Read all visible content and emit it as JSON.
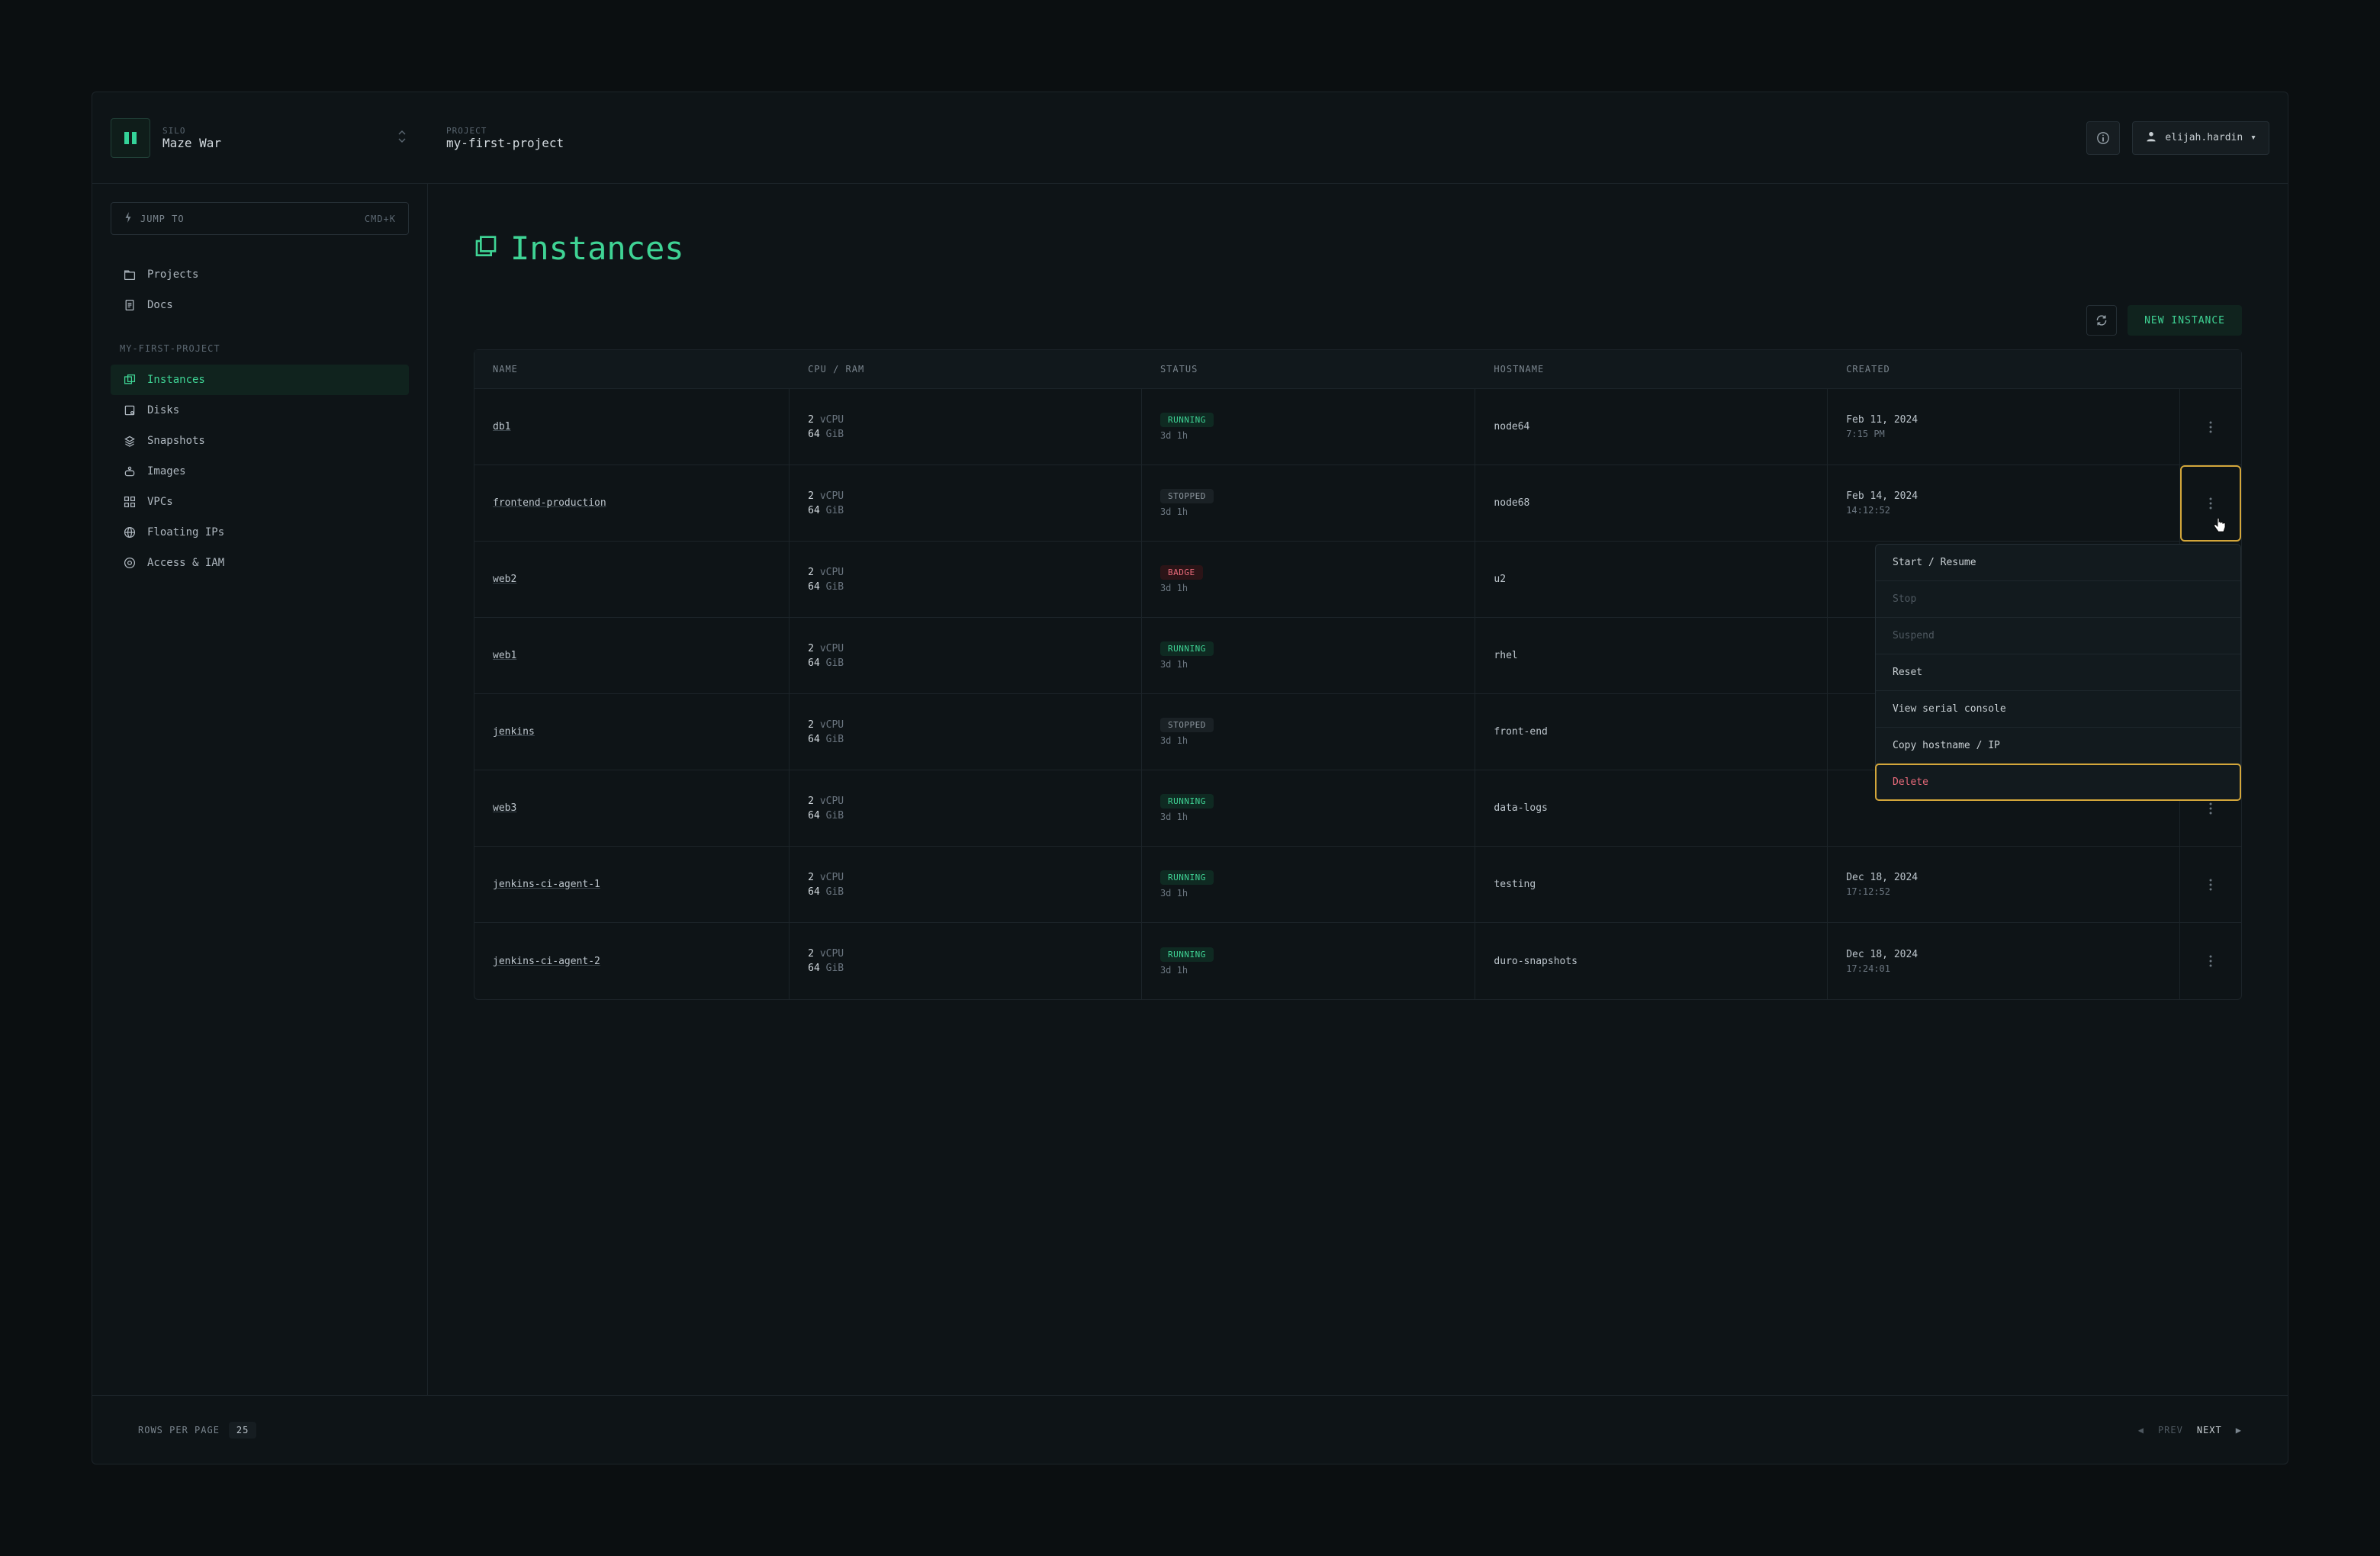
{
  "header": {
    "silo_label": "SILO",
    "silo_name": "Maze War",
    "project_label": "PROJECT",
    "project_name": "my-first-project",
    "username": "elijah.hardin"
  },
  "jump_to": {
    "label": "JUMP TO",
    "kbd": "CMD+K"
  },
  "nav_top": [
    {
      "label": "Projects",
      "icon": "folder"
    },
    {
      "label": "Docs",
      "icon": "doc"
    }
  ],
  "nav_section_label": "MY-FIRST-PROJECT",
  "nav_items": [
    {
      "label": "Instances",
      "icon": "instances",
      "active": true
    },
    {
      "label": "Disks",
      "icon": "disk"
    },
    {
      "label": "Snapshots",
      "icon": "snapshots"
    },
    {
      "label": "Images",
      "icon": "image"
    },
    {
      "label": "VPCs",
      "icon": "vpc"
    },
    {
      "label": "Floating IPs",
      "icon": "globe"
    },
    {
      "label": "Access & IAM",
      "icon": "access"
    }
  ],
  "page_title": "Instances",
  "toolbar": {
    "new_label": "NEW INSTANCE"
  },
  "columns": [
    "NAME",
    "CPU / RAM",
    "STATUS",
    "HOSTNAME",
    "CREATED"
  ],
  "rows": [
    {
      "name": "db1",
      "cpu": "2",
      "cpu_unit": "vCPU",
      "ram": "64",
      "ram_unit": "GiB",
      "status": "RUNNING",
      "status_kind": "running",
      "uptime": "3d 1h",
      "hostname": "node64",
      "created1": "Feb 11, 2024",
      "created2": "7:15 PM"
    },
    {
      "name": "frontend-production",
      "cpu": "2",
      "cpu_unit": "vCPU",
      "ram": "64",
      "ram_unit": "GiB",
      "status": "STOPPED",
      "status_kind": "stopped",
      "uptime": "3d 1h",
      "hostname": "node68",
      "created1": "Feb 14, 2024",
      "created2": "14:12:52",
      "menu_open": true,
      "more_focused": true
    },
    {
      "name": "web2",
      "cpu": "2",
      "cpu_unit": "vCPU",
      "ram": "64",
      "ram_unit": "GiB",
      "status": "BADGE",
      "status_kind": "badge-red",
      "uptime": "3d 1h",
      "hostname": "u2",
      "created1": "",
      "created2": ""
    },
    {
      "name": "web1",
      "cpu": "2",
      "cpu_unit": "vCPU",
      "ram": "64",
      "ram_unit": "GiB",
      "status": "RUNNING",
      "status_kind": "running",
      "uptime": "3d 1h",
      "hostname": "rhel",
      "created1": "",
      "created2": ""
    },
    {
      "name": "jenkins",
      "cpu": "2",
      "cpu_unit": "vCPU",
      "ram": "64",
      "ram_unit": "GiB",
      "status": "STOPPED",
      "status_kind": "stopped",
      "uptime": "3d 1h",
      "hostname": "front-end",
      "created1": "",
      "created2": ""
    },
    {
      "name": "web3",
      "cpu": "2",
      "cpu_unit": "vCPU",
      "ram": "64",
      "ram_unit": "GiB",
      "status": "RUNNING",
      "status_kind": "running",
      "uptime": "3d 1h",
      "hostname": "data-logs",
      "created1": "",
      "created2": ""
    },
    {
      "name": "jenkins-ci-agent-1",
      "cpu": "2",
      "cpu_unit": "vCPU",
      "ram": "64",
      "ram_unit": "GiB",
      "status": "RUNNING",
      "status_kind": "running",
      "uptime": "3d 1h",
      "hostname": "testing",
      "created1": "Dec 18, 2024",
      "created2": "17:12:52"
    },
    {
      "name": "jenkins-ci-agent-2",
      "cpu": "2",
      "cpu_unit": "vCPU",
      "ram": "64",
      "ram_unit": "GiB",
      "status": "RUNNING",
      "status_kind": "running",
      "uptime": "3d 1h",
      "hostname": "duro-snapshots",
      "created1": "Dec 18, 2024",
      "created2": "17:24:01"
    }
  ],
  "row_menu": [
    {
      "label": "Start / Resume",
      "state": "enabled"
    },
    {
      "label": "Stop",
      "state": "disabled"
    },
    {
      "label": "Suspend",
      "state": "disabled"
    },
    {
      "label": "Reset",
      "state": "enabled"
    },
    {
      "label": "View serial console",
      "state": "enabled"
    },
    {
      "label": "Copy hostname / IP",
      "state": "enabled"
    },
    {
      "label": "Delete",
      "state": "danger"
    }
  ],
  "footer": {
    "rpp_label": "ROWS PER PAGE",
    "rpp_value": "25",
    "prev": "PREV",
    "next": "NEXT"
  }
}
